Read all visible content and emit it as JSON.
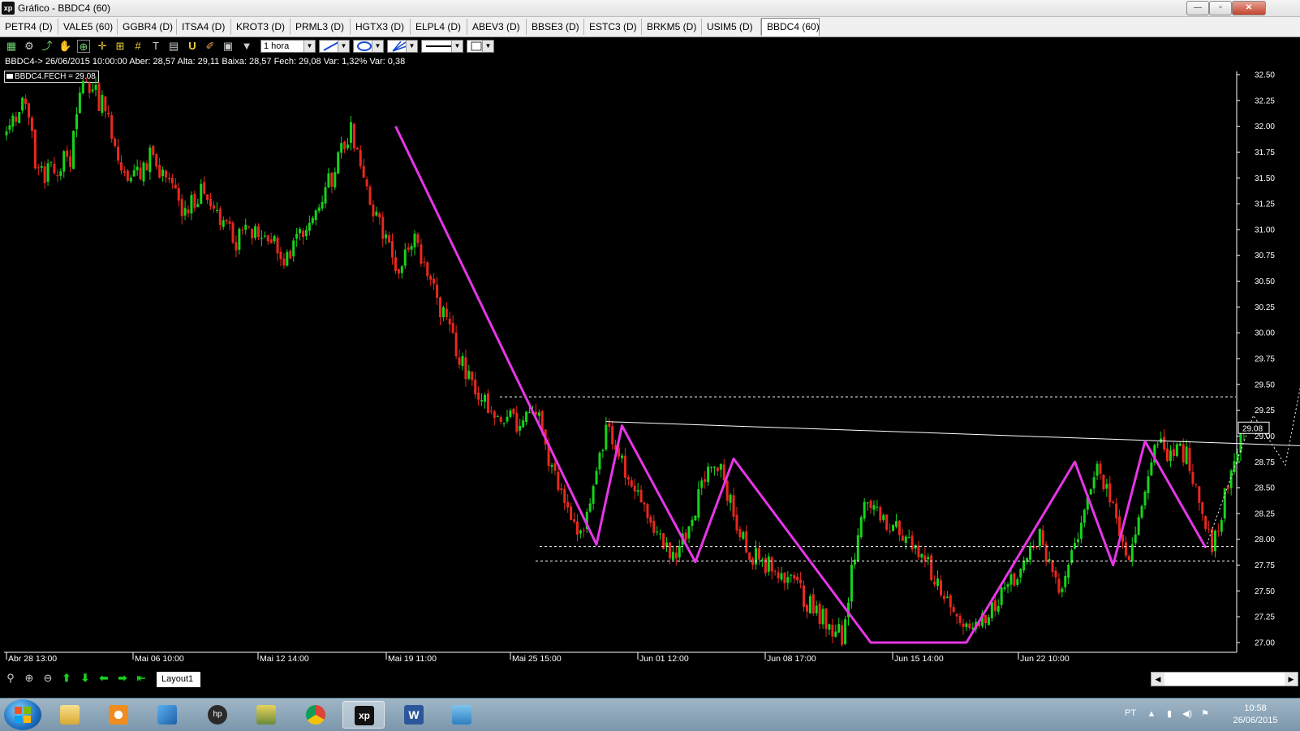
{
  "window": {
    "app_icon": "xp",
    "title": "Gráfico - BBDC4 (60)",
    "controls": {
      "minimize": "—",
      "restore": "▫",
      "close": "✕"
    }
  },
  "tabs": [
    {
      "label": "PETR4 (D)"
    },
    {
      "label": "VALE5 (60)"
    },
    {
      "label": "GGBR4 (D)"
    },
    {
      "label": "ITSA4 (D)"
    },
    {
      "label": "KROT3 (D)"
    },
    {
      "label": "PRML3 (D)"
    },
    {
      "label": "HGTX3 (D)"
    },
    {
      "label": "ELPL4 (D)"
    },
    {
      "label": "ABEV3 (D)"
    },
    {
      "label": "BBSE3 (D)"
    },
    {
      "label": "ESTC3 (D)"
    },
    {
      "label": "BRKM5 (D)"
    },
    {
      "label": "USIM5 (D)"
    },
    {
      "label": "BBDC4 (60)",
      "active": true
    }
  ],
  "toolbar": {
    "period": "1 hora"
  },
  "info_line": "BBDC4-> 26/06/2015 10:00:00 Aber: 28,57 Alta: 29,11 Baixa: 28,57 Fech: 29,08 Var: 1,32% Var: 0,38",
  "legend": "BBDC4.FECH = 29.08",
  "price_tag": "29.08",
  "layout_tab": "Layout1",
  "taskbar": {
    "language": "PT",
    "time": "10:58",
    "date": "26/06/2015"
  },
  "colors": {
    "background": "#000000",
    "bull": "#17d31b",
    "bear": "#e8281e",
    "trend": "#e636e6",
    "guide": "#ffffff"
  },
  "chart_data": {
    "type": "candlestick",
    "symbol": "BBDC4",
    "interval": "1 hora",
    "ylim": [
      26.95,
      32.6
    ],
    "y_ticks": [
      "32.50",
      "32.25",
      "32.00",
      "31.75",
      "31.50",
      "31.25",
      "31.00",
      "30.75",
      "30.50",
      "30.25",
      "30.00",
      "29.75",
      "29.50",
      "29.25",
      "29.00",
      "28.75",
      "28.50",
      "28.25",
      "28.00",
      "27.75",
      "27.50",
      "27.25",
      "27.00"
    ],
    "x_ticks": [
      "Abr 28 13:00",
      "Mai 06 10:00",
      "Mai 12 14:00",
      "Mai 19 11:00",
      "Mai 25 15:00",
      "Jun 01 12:00",
      "Jun 08 17:00",
      "Jun 15 14:00",
      "Jun 22 10:00"
    ],
    "n_bars": 300,
    "path_points": [
      [
        0,
        31.9
      ],
      [
        6,
        32.3
      ],
      [
        10,
        31.5
      ],
      [
        20,
        31.7
      ],
      [
        24,
        32.5
      ],
      [
        32,
        32.1
      ],
      [
        38,
        31.4
      ],
      [
        45,
        31.7
      ],
      [
        55,
        31.2
      ],
      [
        62,
        31.4
      ],
      [
        72,
        30.9
      ],
      [
        80,
        31.0
      ],
      [
        88,
        30.7
      ],
      [
        98,
        31.2
      ],
      [
        108,
        32.0
      ],
      [
        114,
        31.3
      ],
      [
        122,
        30.6
      ],
      [
        128,
        30.9
      ],
      [
        140,
        29.9
      ],
      [
        150,
        29.3
      ],
      [
        160,
        29.1
      ],
      [
        166,
        29.3
      ],
      [
        170,
        28.7
      ],
      [
        180,
        28.0
      ],
      [
        188,
        29.1
      ],
      [
        200,
        28.3
      ],
      [
        210,
        27.8
      ],
      [
        222,
        28.8
      ],
      [
        232,
        27.9
      ],
      [
        248,
        27.5
      ],
      [
        262,
        27.05
      ],
      [
        268,
        28.3
      ],
      [
        284,
        28.0
      ],
      [
        292,
        27.6
      ],
      [
        302,
        27.05
      ],
      [
        324,
        28.0
      ],
      [
        330,
        27.5
      ],
      [
        342,
        28.7
      ],
      [
        352,
        27.8
      ],
      [
        360,
        28.9
      ],
      [
        370,
        28.8
      ],
      [
        378,
        27.95
      ],
      [
        388,
        29.1
      ]
    ],
    "last_close": 29.08,
    "support_levels": [
      29.38,
      27.93,
      27.79
    ],
    "resistance_line": [
      [
        188,
        29.14
      ],
      [
        421,
        28.89
      ]
    ],
    "trend_segments": [
      [
        122,
        32.0
      ],
      [
        185,
        27.95
      ],
      [
        193,
        29.1
      ],
      [
        216,
        27.78
      ],
      [
        228,
        28.78
      ],
      [
        271,
        27.0
      ],
      [
        301,
        27.0
      ],
      [
        335,
        28.75
      ],
      [
        347,
        27.75
      ],
      [
        357,
        28.95
      ],
      [
        376,
        27.92
      ]
    ],
    "projection": [
      [
        376,
        27.92
      ],
      [
        391,
        29.2
      ],
      [
        401,
        28.72
      ],
      [
        418,
        31.45
      ]
    ]
  }
}
